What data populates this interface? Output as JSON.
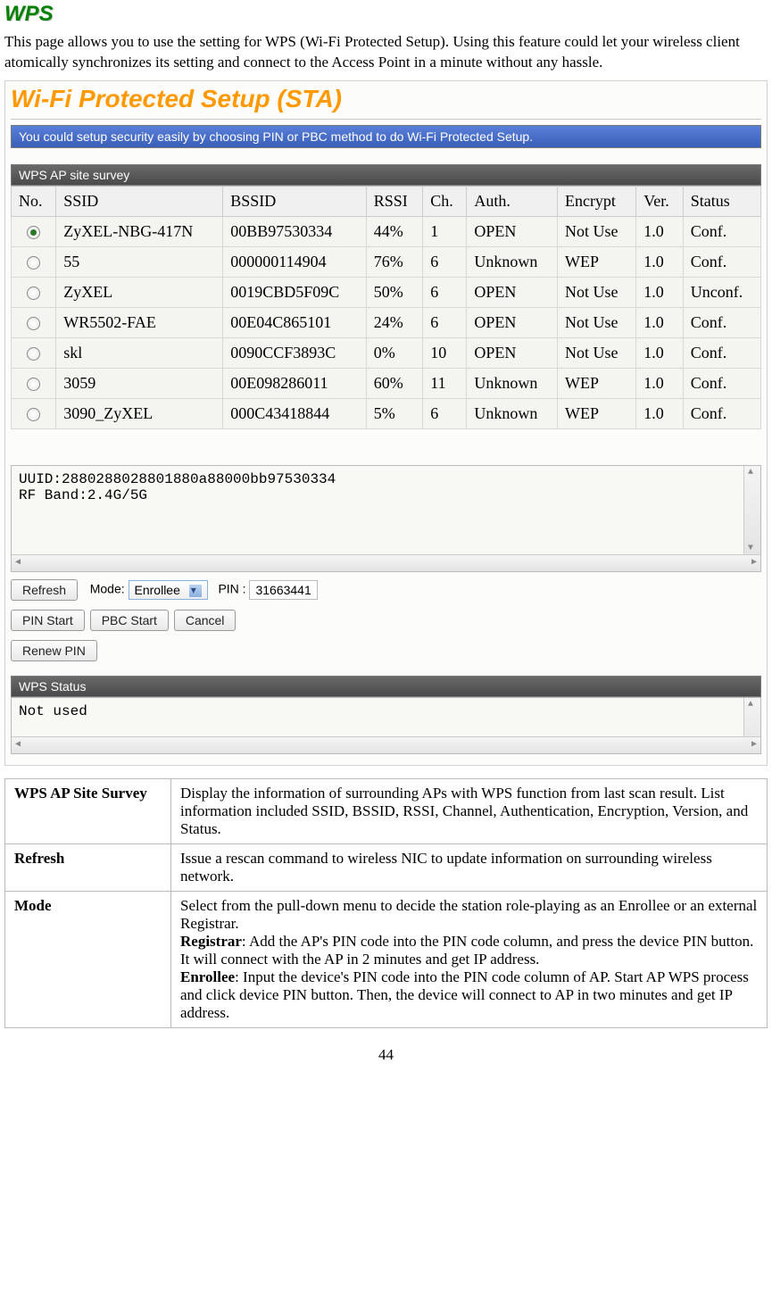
{
  "section": {
    "title": "WPS",
    "intro": "This page allows you to use the setting for WPS (Wi-Fi Protected Setup). Using this feature could let your wireless client atomically synchronizes its setting and connect to the Access Point in a minute without any hassle."
  },
  "panel": {
    "title": "Wi-Fi Protected Setup (STA)",
    "info_bar": "You could setup security easily by choosing PIN or PBC method to do Wi-Fi Protected Setup.",
    "survey_header": "WPS AP site survey"
  },
  "survey": {
    "columns": [
      "No.",
      "SSID",
      "BSSID",
      "RSSI",
      "Ch.",
      "Auth.",
      "Encrypt",
      "Ver.",
      "Status"
    ],
    "rows": [
      {
        "selected": true,
        "ssid": "ZyXEL-NBG-417N",
        "bssid": "00BB97530334",
        "rssi": "44%",
        "ch": "1",
        "auth": "OPEN",
        "encrypt": "Not Use",
        "ver": "1.0",
        "status": "Conf."
      },
      {
        "selected": false,
        "ssid": "55",
        "bssid": "000000114904",
        "rssi": "76%",
        "ch": "6",
        "auth": "Unknown",
        "encrypt": "WEP",
        "ver": "1.0",
        "status": "Conf."
      },
      {
        "selected": false,
        "ssid": "ZyXEL",
        "bssid": "0019CBD5F09C",
        "rssi": "50%",
        "ch": "6",
        "auth": "OPEN",
        "encrypt": "Not Use",
        "ver": "1.0",
        "status": "Unconf."
      },
      {
        "selected": false,
        "ssid": "WR5502-FAE",
        "bssid": "00E04C865101",
        "rssi": "24%",
        "ch": "6",
        "auth": "OPEN",
        "encrypt": "Not Use",
        "ver": "1.0",
        "status": "Conf."
      },
      {
        "selected": false,
        "ssid": "skl",
        "bssid": "0090CCF3893C",
        "rssi": "0%",
        "ch": "10",
        "auth": "OPEN",
        "encrypt": "Not Use",
        "ver": "1.0",
        "status": "Conf."
      },
      {
        "selected": false,
        "ssid": "3059",
        "bssid": "00E098286011",
        "rssi": "60%",
        "ch": "11",
        "auth": "Unknown",
        "encrypt": "WEP",
        "ver": "1.0",
        "status": "Conf."
      },
      {
        "selected": false,
        "ssid": "3090_ZyXEL",
        "bssid": "000C43418844",
        "rssi": "5%",
        "ch": "6",
        "auth": "Unknown",
        "encrypt": "WEP",
        "ver": "1.0",
        "status": "Conf."
      }
    ]
  },
  "uuid": {
    "line1": "UUID:2880288028801880a88000bb97530334",
    "line2": "RF Band:2.4G/5G"
  },
  "controls": {
    "refresh": "Refresh",
    "mode_label": "Mode:",
    "mode_value": "Enrollee",
    "pin_label": "PIN :",
    "pin_value": "31663441",
    "pin_start": "PIN Start",
    "pbc_start": "PBC Start",
    "cancel": "Cancel",
    "renew_pin": "Renew PIN"
  },
  "status": {
    "header": "WPS Status",
    "text": "Not used"
  },
  "desc": {
    "rows": [
      {
        "key": "WPS AP Site Survey",
        "val": "Display the information of surrounding APs with WPS function from last scan result. List information included SSID, BSSID, RSSI, Channel, Authentication, Encryption, Version, and Status."
      },
      {
        "key": "Refresh",
        "val": "Issue a rescan command to wireless NIC to update information on surrounding wireless network."
      }
    ],
    "mode_key": "Mode",
    "mode_intro": "Select from the pull-down menu to decide the station role-playing as an Enrollee or an external Registrar.",
    "registrar_label": "Registrar",
    "registrar_text": ": Add the AP's PIN code into the PIN code column, and press the device PIN button. It will connect with the AP in 2 minutes and get IP address.",
    "enrollee_label": "Enrollee",
    "enrollee_text": ": Input the device's PIN code into the PIN code column of AP. Start AP WPS process and click device PIN button. Then, the device will connect to AP in two minutes and get IP address."
  },
  "page_number": "44"
}
